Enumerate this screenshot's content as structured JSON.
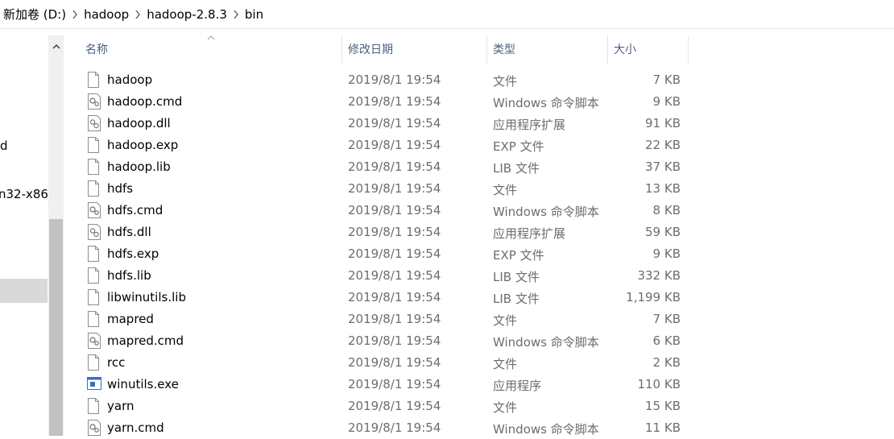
{
  "breadcrumb": [
    "新加卷 (D:)",
    "hadoop",
    "hadoop-2.8.3",
    "bin"
  ],
  "nav": {
    "items": [
      "d",
      "n32-x86_"
    ]
  },
  "columns": {
    "name": "名称",
    "date": "修改日期",
    "type": "类型",
    "size": "大小"
  },
  "files": [
    {
      "name": "hadoop",
      "date": "2019/8/1 19:54",
      "type": "文件",
      "size": "7 KB",
      "icon": "file-icon"
    },
    {
      "name": "hadoop.cmd",
      "date": "2019/8/1 19:54",
      "type": "Windows 命令脚本",
      "size": "9 KB",
      "icon": "script-file-icon"
    },
    {
      "name": "hadoop.dll",
      "date": "2019/8/1 19:54",
      "type": "应用程序扩展",
      "size": "91 KB",
      "icon": "dll-file-icon"
    },
    {
      "name": "hadoop.exp",
      "date": "2019/8/1 19:54",
      "type": "EXP 文件",
      "size": "22 KB",
      "icon": "file-icon"
    },
    {
      "name": "hadoop.lib",
      "date": "2019/8/1 19:54",
      "type": "LIB 文件",
      "size": "37 KB",
      "icon": "file-icon"
    },
    {
      "name": "hdfs",
      "date": "2019/8/1 19:54",
      "type": "文件",
      "size": "13 KB",
      "icon": "file-icon"
    },
    {
      "name": "hdfs.cmd",
      "date": "2019/8/1 19:54",
      "type": "Windows 命令脚本",
      "size": "8 KB",
      "icon": "script-file-icon"
    },
    {
      "name": "hdfs.dll",
      "date": "2019/8/1 19:54",
      "type": "应用程序扩展",
      "size": "59 KB",
      "icon": "dll-file-icon"
    },
    {
      "name": "hdfs.exp",
      "date": "2019/8/1 19:54",
      "type": "EXP 文件",
      "size": "9 KB",
      "icon": "file-icon"
    },
    {
      "name": "hdfs.lib",
      "date": "2019/8/1 19:54",
      "type": "LIB 文件",
      "size": "332 KB",
      "icon": "file-icon"
    },
    {
      "name": "libwinutils.lib",
      "date": "2019/8/1 19:54",
      "type": "LIB 文件",
      "size": "1,199 KB",
      "icon": "file-icon"
    },
    {
      "name": "mapred",
      "date": "2019/8/1 19:54",
      "type": "文件",
      "size": "7 KB",
      "icon": "file-icon"
    },
    {
      "name": "mapred.cmd",
      "date": "2019/8/1 19:54",
      "type": "Windows 命令脚本",
      "size": "6 KB",
      "icon": "script-file-icon"
    },
    {
      "name": "rcc",
      "date": "2019/8/1 19:54",
      "type": "文件",
      "size": "2 KB",
      "icon": "file-icon"
    },
    {
      "name": "winutils.exe",
      "date": "2019/8/1 19:54",
      "type": "应用程序",
      "size": "110 KB",
      "icon": "exe-file-icon"
    },
    {
      "name": "yarn",
      "date": "2019/8/1 19:54",
      "type": "文件",
      "size": "15 KB",
      "icon": "file-icon"
    },
    {
      "name": "yarn.cmd",
      "date": "2019/8/1 19:54",
      "type": "Windows 命令脚本",
      "size": "11 KB",
      "icon": "script-file-icon"
    }
  ]
}
